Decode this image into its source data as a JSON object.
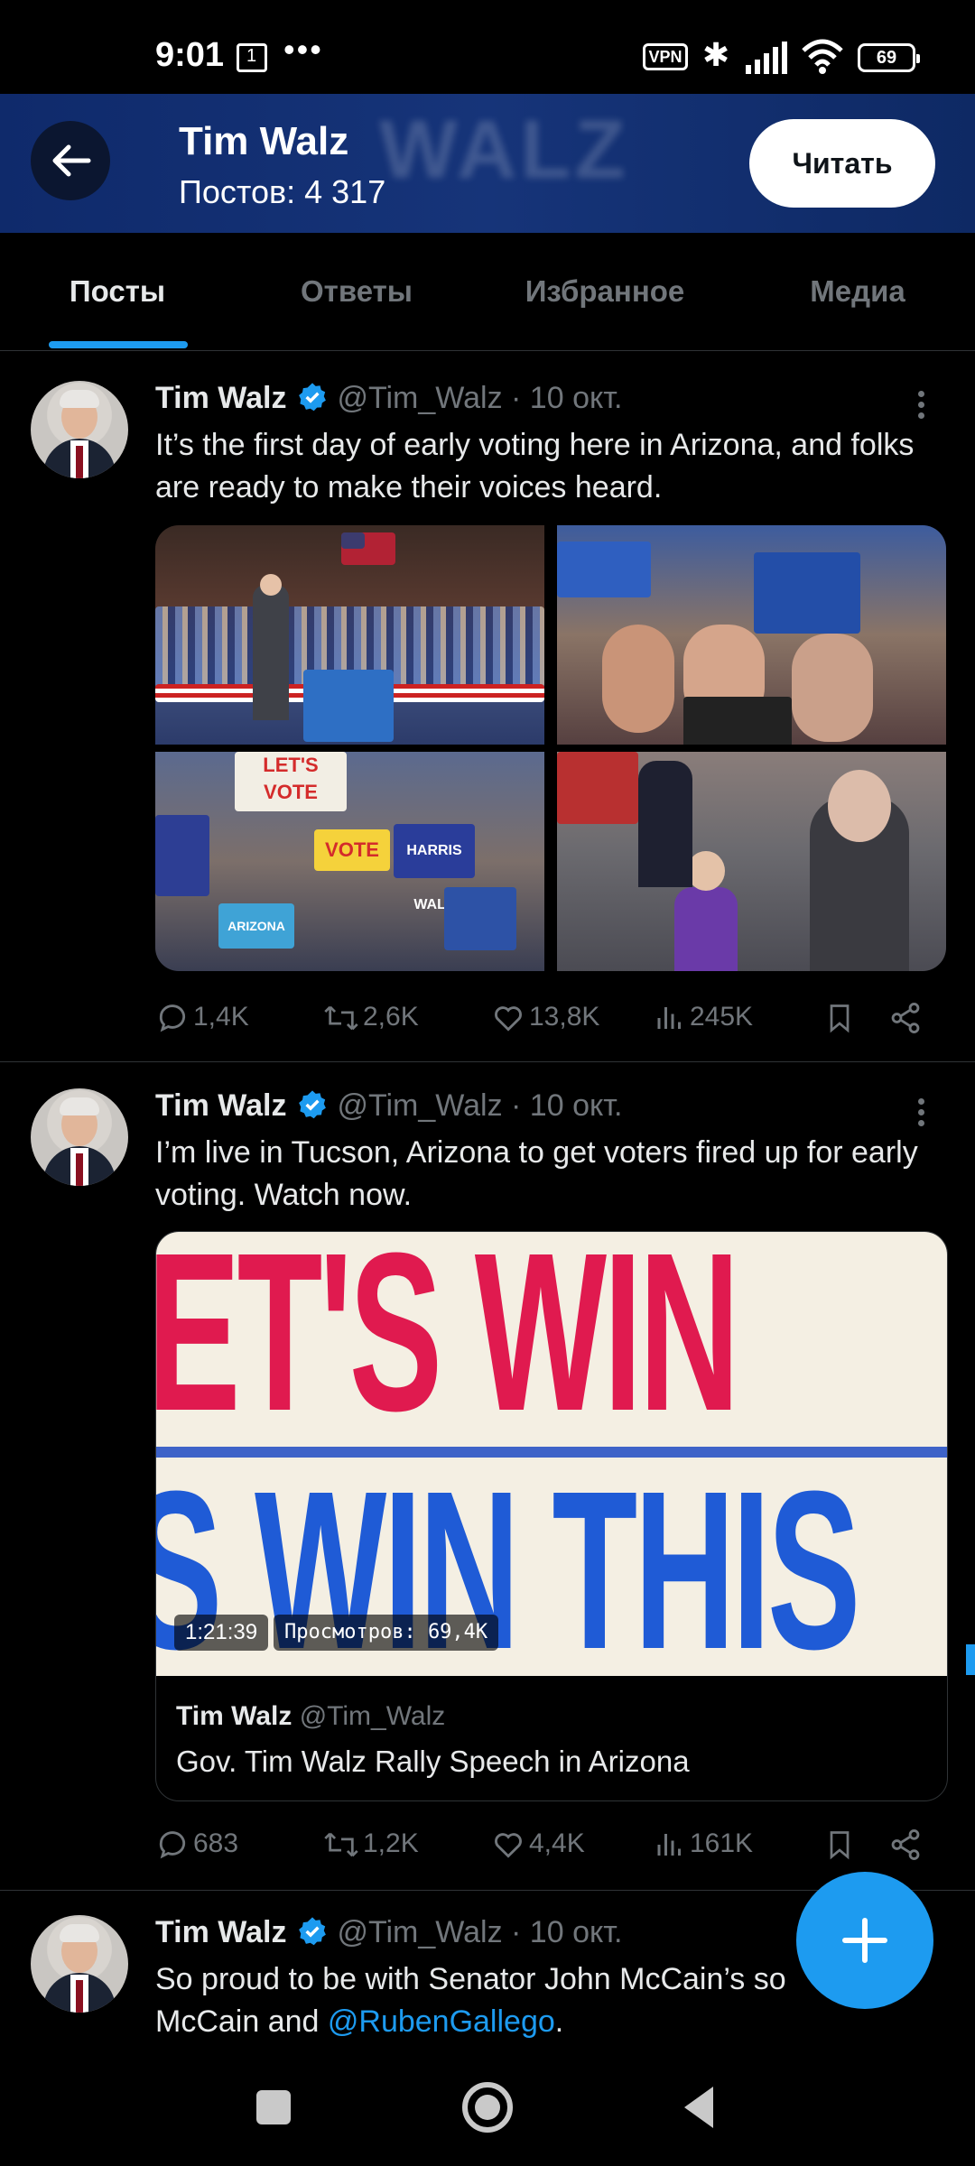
{
  "status_bar": {
    "time": "9:01",
    "notif_icon": "box-1-icon",
    "dots": "•••",
    "vpn": "VPN",
    "battery": "69"
  },
  "header": {
    "banner_text": "WALZ",
    "name": "Tim Walz",
    "post_count": "Постов: 4 317",
    "follow_label": "Читать"
  },
  "tabs": [
    "Посты",
    "Ответы",
    "Избранное",
    "Медиа"
  ],
  "posts": [
    {
      "author": "Tim Walz",
      "handle": "@Tim_Walz",
      "date": "· 10 окт.",
      "text": "It’s the first day of early voting here in Arizona, and folks are ready to make their voices heard.",
      "stats": {
        "replies": "1,4K",
        "reposts": "2,6K",
        "likes": "13,8K",
        "views": "245K"
      },
      "media_signs": [
        "LET'S VOTE",
        "VOTE",
        "HARRIS WALZ",
        "ARIZONA"
      ]
    },
    {
      "author": "Tim Walz",
      "handle": "@Tim_Walz",
      "date": "· 10 окт.",
      "text": "I’m live in Tucson, Arizona to get voters fired up for early voting. Watch now.",
      "video": {
        "duration": "1:21:39",
        "views": "Просмотров: 69,4K",
        "card_author": "Tim Walz",
        "card_handle": "@Tim_Walz",
        "card_title": "Gov. Tim Walz Rally Speech in Arizona",
        "frame_line1": "ET'S WIN",
        "frame_line2": "S WIN THIS"
      },
      "stats": {
        "replies": "683",
        "reposts": "1,2K",
        "likes": "4,4K",
        "views": "161K"
      }
    },
    {
      "author": "Tim Walz",
      "handle": "@Tim_Walz",
      "date": "· 10 окт.",
      "text_before": "So proud to be with Senator John McCain’s so",
      "text_line2_before": "McCain and ",
      "mention": "@RubenGallego",
      "text_after": "."
    }
  ],
  "colors": {
    "accent": "#1d9bf0",
    "background": "#000000",
    "muted_text": "#71767b",
    "header_blue": "#163479",
    "video_red": "#e01a4f",
    "video_blue": "#1f5bd6"
  }
}
